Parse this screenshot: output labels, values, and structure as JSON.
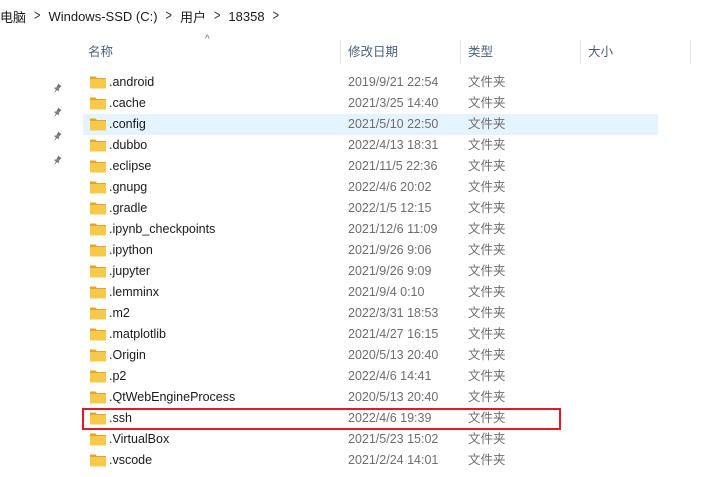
{
  "breadcrumb": {
    "segments": [
      "电脑",
      "Windows-SSD (C:)",
      "用户",
      "18358"
    ],
    "separator": ">"
  },
  "columns": {
    "name": "名称",
    "modified": "修改日期",
    "type": "类型",
    "size": "大小"
  },
  "sort_indicator": "^",
  "colors": {
    "selected_row": "#e5f3ff",
    "highlight_border": "#e01b24",
    "folder": "#f6c94a"
  },
  "files": [
    {
      "name": ".android",
      "modified": "2019/9/21 22:54",
      "type": "文件夹"
    },
    {
      "name": ".cache",
      "modified": "2021/3/25 14:40",
      "type": "文件夹"
    },
    {
      "name": ".config",
      "modified": "2021/5/10 22:50",
      "type": "文件夹",
      "selected": true
    },
    {
      "name": ".dubbo",
      "modified": "2022/4/13 18:31",
      "type": "文件夹"
    },
    {
      "name": ".eclipse",
      "modified": "2021/11/5 22:36",
      "type": "文件夹"
    },
    {
      "name": ".gnupg",
      "modified": "2022/4/6 20:02",
      "type": "文件夹"
    },
    {
      "name": ".gradle",
      "modified": "2022/1/5 12:15",
      "type": "文件夹"
    },
    {
      "name": ".ipynb_checkpoints",
      "modified": "2021/12/6 11:09",
      "type": "文件夹"
    },
    {
      "name": ".ipython",
      "modified": "2021/9/26 9:06",
      "type": "文件夹"
    },
    {
      "name": ".jupyter",
      "modified": "2021/9/26 9:09",
      "type": "文件夹"
    },
    {
      "name": ".lemminx",
      "modified": "2021/9/4 0:10",
      "type": "文件夹"
    },
    {
      "name": ".m2",
      "modified": "2022/3/31 18:53",
      "type": "文件夹"
    },
    {
      "name": ".matplotlib",
      "modified": "2021/4/27 16:15",
      "type": "文件夹"
    },
    {
      "name": ".Origin",
      "modified": "2020/5/13 20:40",
      "type": "文件夹"
    },
    {
      "name": ".p2",
      "modified": "2022/4/6 14:41",
      "type": "文件夹"
    },
    {
      "name": ".QtWebEngineProcess",
      "modified": "2020/5/13 20:40",
      "type": "文件夹"
    },
    {
      "name": ".ssh",
      "modified": "2022/4/6 19:39",
      "type": "文件夹",
      "highlighted": true
    },
    {
      "name": ".VirtualBox",
      "modified": "2021/5/23 15:02",
      "type": "文件夹"
    },
    {
      "name": ".vscode",
      "modified": "2021/2/24 14:01",
      "type": "文件夹"
    }
  ]
}
